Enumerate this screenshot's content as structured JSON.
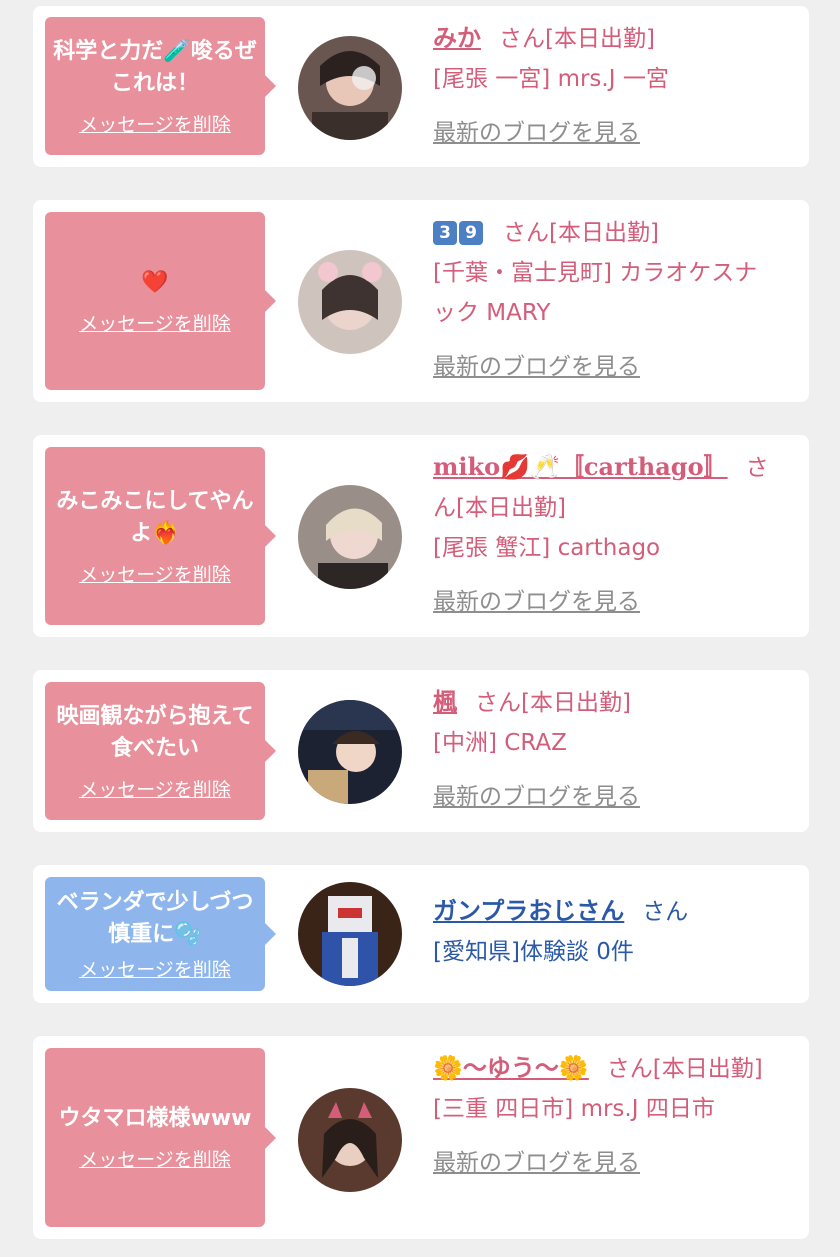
{
  "messages": [
    {
      "bubble_text": "科学と力だ🧪唆るぜこれは！",
      "delete_label": "メッセージを削除",
      "name": "みか",
      "suffix": "さん[本日出勤]",
      "location": "[尾張 一宮] mrs.J 一宮",
      "blog": "最新のブログを見る"
    },
    {
      "bubble_text": "❤️",
      "delete_label": "メッセージを削除",
      "name": "3 9",
      "suffix": "さん[本日出勤]",
      "location": "[千葉・富士見町] カラオケスナック MARY",
      "blog": "最新のブログを見る"
    },
    {
      "bubble_text": "みこみこにしてやんよ❤️‍🔥",
      "delete_label": "メッセージを削除",
      "name": "miko💋🥂〚carthago〛",
      "suffix": "さん[本日出勤]",
      "location": "[尾張 蟹江] carthago",
      "blog": "最新のブログを見る"
    },
    {
      "bubble_text": "映画観ながら抱えて食べたい",
      "delete_label": "メッセージを削除",
      "name": "楓",
      "suffix": "さん[本日出勤]",
      "location": "[中洲] CRAZ",
      "blog": "最新のブログを見る"
    },
    {
      "bubble_text": "ベランダで少しづつ慎重に🫧",
      "delete_label": "メッセージを削除",
      "name": "ガンプラおじさん",
      "suffix": "さん",
      "location": "[愛知県]体験談 0件"
    },
    {
      "bubble_text": "ウタマロ様様www",
      "delete_label": "メッセージを削除",
      "name": "🌼〜ゆう〜🌼",
      "suffix": "さん[本日出勤]",
      "location": "[三重 四日市] mrs.J 四日市",
      "blog": "最新のブログを見る"
    }
  ],
  "colors": {
    "pink_bubble": "#e8909b",
    "blue_bubble": "#8eb6ec",
    "pink_text": "#d45d7a",
    "blue_text": "#2a5aa7",
    "blog_link": "#8e8e8e",
    "background": "#efefef"
  }
}
